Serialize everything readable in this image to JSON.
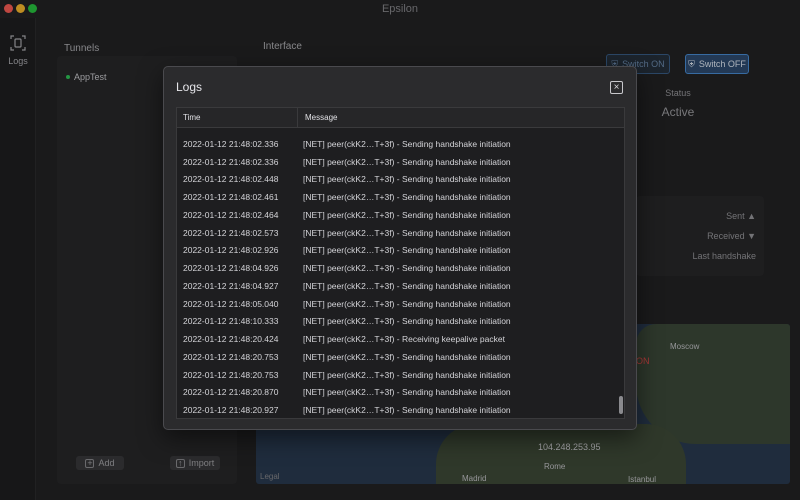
{
  "app": {
    "title": "Epsilon"
  },
  "rail": {
    "logs_label": "Logs",
    "icon": "logs-icon"
  },
  "tunnels": {
    "title": "Tunnels",
    "items": [
      {
        "name": "AppTest",
        "status_color": "#30c85a"
      }
    ],
    "add_label": "Add",
    "import_label": "Import"
  },
  "interface": {
    "title": "Interface",
    "switch_on_label": "Switch ON",
    "switch_off_label": "Switch OFF",
    "status_label": "Status",
    "status_value": "Active",
    "stats": {
      "sent": "Sent ▲",
      "received": "Received ▼",
      "last_handshake": "Last handshake"
    },
    "map": {
      "cities": [
        "Moscow",
        "Rome",
        "Madrid",
        "Istanbul"
      ],
      "ip": "104.248.253.95",
      "red_label": "ON",
      "legal": "Legal"
    }
  },
  "logs_modal": {
    "title": "Logs",
    "columns": {
      "time": "Time",
      "message": "Message"
    },
    "rows": [
      {
        "time": "2022-01-12 21:48:02.336",
        "message": "[NET] peer(ckK2…T+3f) - Sending handshake initiation"
      },
      {
        "time": "2022-01-12 21:48:02.336",
        "message": "[NET] peer(ckK2…T+3f) - Sending handshake initiation"
      },
      {
        "time": "2022-01-12 21:48:02.448",
        "message": "[NET] peer(ckK2…T+3f) - Sending handshake initiation"
      },
      {
        "time": "2022-01-12 21:48:02.461",
        "message": "[NET] peer(ckK2…T+3f) - Sending handshake initiation"
      },
      {
        "time": "2022-01-12 21:48:02.464",
        "message": "[NET] peer(ckK2…T+3f) - Sending handshake initiation"
      },
      {
        "time": "2022-01-12 21:48:02.573",
        "message": "[NET] peer(ckK2…T+3f) - Sending handshake initiation"
      },
      {
        "time": "2022-01-12 21:48:02.926",
        "message": "[NET] peer(ckK2…T+3f) - Sending handshake initiation"
      },
      {
        "time": "2022-01-12 21:48:04.926",
        "message": "[NET] peer(ckK2…T+3f) - Sending handshake initiation"
      },
      {
        "time": "2022-01-12 21:48:04.927",
        "message": "[NET] peer(ckK2…T+3f) - Sending handshake initiation"
      },
      {
        "time": "2022-01-12 21:48:05.040",
        "message": "[NET] peer(ckK2…T+3f) - Sending handshake initiation"
      },
      {
        "time": "2022-01-12 21:48:10.333",
        "message": "[NET] peer(ckK2…T+3f) - Sending handshake initiation"
      },
      {
        "time": "2022-01-12 21:48:20.424",
        "message": "[NET] peer(ckK2…T+3f) - Receiving keepalive packet"
      },
      {
        "time": "2022-01-12 21:48:20.753",
        "message": "[NET] peer(ckK2…T+3f) - Sending handshake initiation"
      },
      {
        "time": "2022-01-12 21:48:20.753",
        "message": "[NET] peer(ckK2…T+3f) - Sending handshake initiation"
      },
      {
        "time": "2022-01-12 21:48:20.870",
        "message": "[NET] peer(ckK2…T+3f) - Sending handshake initiation"
      },
      {
        "time": "2022-01-12 21:48:20.927",
        "message": "[NET] peer(ckK2…T+3f) - Sending handshake initiation"
      }
    ]
  },
  "colors": {
    "accent": "#4a8fd8",
    "active_green": "#30c85a"
  }
}
